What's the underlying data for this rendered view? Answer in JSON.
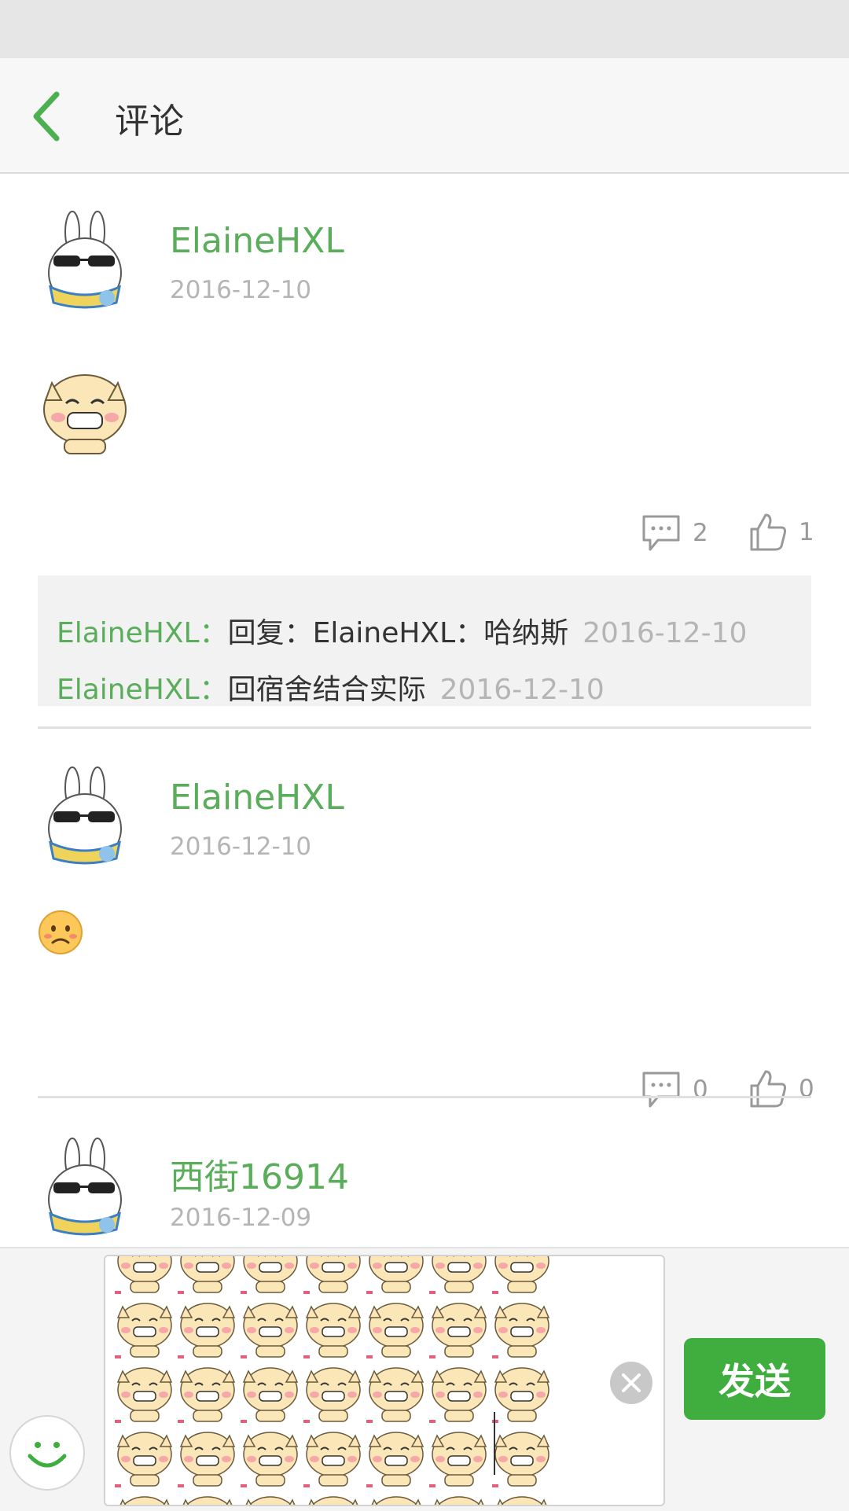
{
  "header": {
    "title": "评论"
  },
  "comments": [
    {
      "username": "ElaineHXL",
      "date": "2016-12-10",
      "reply_count": "2",
      "like_count": "1",
      "replies": [
        {
          "user": "ElaineHXL：",
          "text": "回复：ElaineHXL：哈纳斯",
          "date": "2016-12-10"
        },
        {
          "user": "ElaineHXL：",
          "text": "回宿舍结合实际",
          "date": "2016-12-10"
        }
      ]
    },
    {
      "username": "ElaineHXL",
      "date": "2016-12-10",
      "reply_count": "0",
      "like_count": "0"
    },
    {
      "username": "西街16914",
      "date": "2016-12-09"
    }
  ],
  "composer": {
    "send_label": "发送"
  },
  "colors": {
    "accent": "#3fae3f",
    "username": "#5aad5a",
    "date": "#b5b5b5"
  }
}
